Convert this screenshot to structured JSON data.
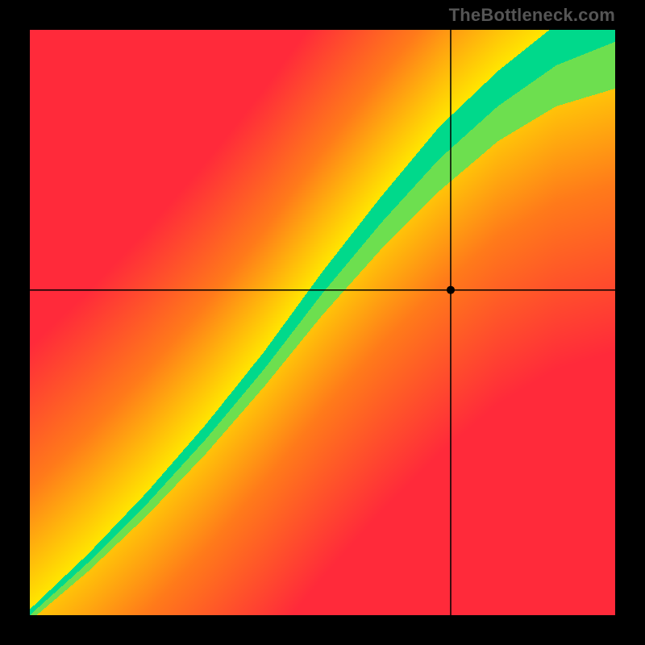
{
  "brand": {
    "watermark": "TheBottleneck.com"
  },
  "chart_data": {
    "type": "heatmap",
    "title": "",
    "xlabel": "",
    "ylabel": "",
    "xlim": [
      0,
      1
    ],
    "ylim": [
      0,
      1
    ],
    "legend": {
      "visible": false
    },
    "grid": false,
    "colormap_description": "red→orange→yellow→green→yellow→orange→red along crosswise distance from diagonal optimum band",
    "crosshair": {
      "x": 0.72,
      "y": 0.555
    },
    "point": {
      "x": 0.72,
      "y": 0.555
    },
    "optimum_band": {
      "description": "green band where components are balanced; slightly convex toward lower y for low x, approaches y=x for high x",
      "samples_x": [
        0.0,
        0.1,
        0.2,
        0.3,
        0.4,
        0.5,
        0.6,
        0.7,
        0.8,
        0.9,
        1.0
      ],
      "center_y": [
        0.0,
        0.09,
        0.19,
        0.3,
        0.42,
        0.55,
        0.67,
        0.78,
        0.87,
        0.94,
        0.98
      ],
      "halfwidth": [
        0.01,
        0.015,
        0.02,
        0.025,
        0.03,
        0.037,
        0.045,
        0.055,
        0.06,
        0.07,
        0.08
      ]
    },
    "color_stops": [
      {
        "value": 0.0,
        "color": "#ff2a3a",
        "meaning": "severe bottleneck"
      },
      {
        "value": 0.35,
        "color": "#ff7a1a",
        "meaning": "bottleneck"
      },
      {
        "value": 0.65,
        "color": "#ffe600",
        "meaning": "mild"
      },
      {
        "value": 1.0,
        "color": "#00d98b",
        "meaning": "balanced"
      }
    ]
  }
}
